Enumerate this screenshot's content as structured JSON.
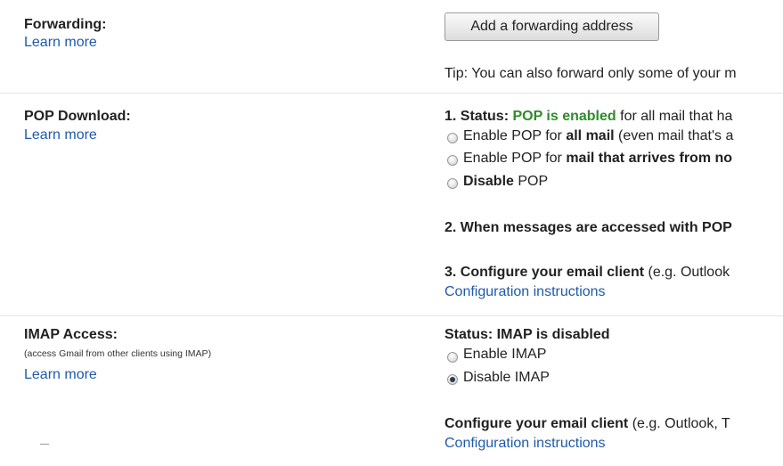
{
  "forwarding": {
    "title": "Forwarding:",
    "learn_more": "Learn more",
    "add_button": "Add a forwarding address",
    "tip": "Tip: You can also forward only some of your m"
  },
  "pop": {
    "title": "POP Download:",
    "learn_more": "Learn more",
    "status_prefix": "1. Status: ",
    "status_value": "POP is enabled",
    "status_suffix": " for all mail that ha",
    "options": [
      {
        "pre": "Enable POP for ",
        "bold": "all mail",
        "post": " (even mail that's a",
        "checked": false
      },
      {
        "pre": "Enable POP for ",
        "bold": "mail that arrives from no",
        "post": "",
        "checked": false
      },
      {
        "pre": "",
        "bold": "Disable",
        "post": " POP",
        "checked": false
      }
    ],
    "step2": "2. When messages are accessed with POP",
    "step3_bold": "3. Configure your email client",
    "step3_rest": " (e.g. Outlook",
    "config_link": "Configuration instructions"
  },
  "imap": {
    "title": "IMAP Access:",
    "subtitle": "(access Gmail from other clients using IMAP)",
    "learn_more": "Learn more",
    "status": "Status: IMAP is disabled",
    "options": [
      {
        "label": "Enable IMAP",
        "checked": false
      },
      {
        "label": "Disable IMAP",
        "checked": true
      }
    ],
    "configure_bold": "Configure your email client",
    "configure_rest": " (e.g. Outlook, T",
    "config_link": "Configuration instructions"
  },
  "colors": {
    "link": "#1f5aa8",
    "enabled_green": "#2e8b29",
    "separator": "#e5e5e5"
  }
}
